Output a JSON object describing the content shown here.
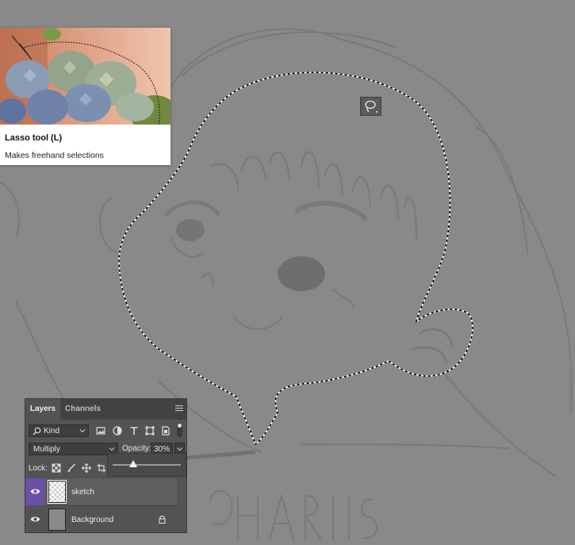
{
  "tooltip": {
    "title": "Lasso tool (L)",
    "description": "Makes freehand selections"
  },
  "cursor": {
    "icon": "lasso-icon"
  },
  "layers_panel": {
    "tabs": [
      {
        "label": "Layers",
        "active": true
      },
      {
        "label": "Channels",
        "active": false
      }
    ],
    "filter": {
      "kind_label": "Kind",
      "icons": [
        "image-filter-icon",
        "adjustment-filter-icon",
        "type-filter-icon",
        "shape-filter-icon",
        "smart-object-filter-icon"
      ]
    },
    "blend_mode": "Multiply",
    "opacity_label": "Opacity:",
    "opacity_value": "30%",
    "opacity_slider_fraction": 0.3,
    "lock_label": "Lock:",
    "lock_icons": [
      "lock-transparent-icon",
      "lock-image-icon",
      "lock-position-icon",
      "lock-artboard-icon"
    ],
    "layers": [
      {
        "name": "sketch",
        "visible": true,
        "selected": true,
        "locked": false
      },
      {
        "name": "Background",
        "visible": true,
        "selected": false,
        "locked": true
      }
    ]
  },
  "colors": {
    "canvas": "#898989",
    "panel": "#535353",
    "selection_accent": "#6b4fa8"
  }
}
